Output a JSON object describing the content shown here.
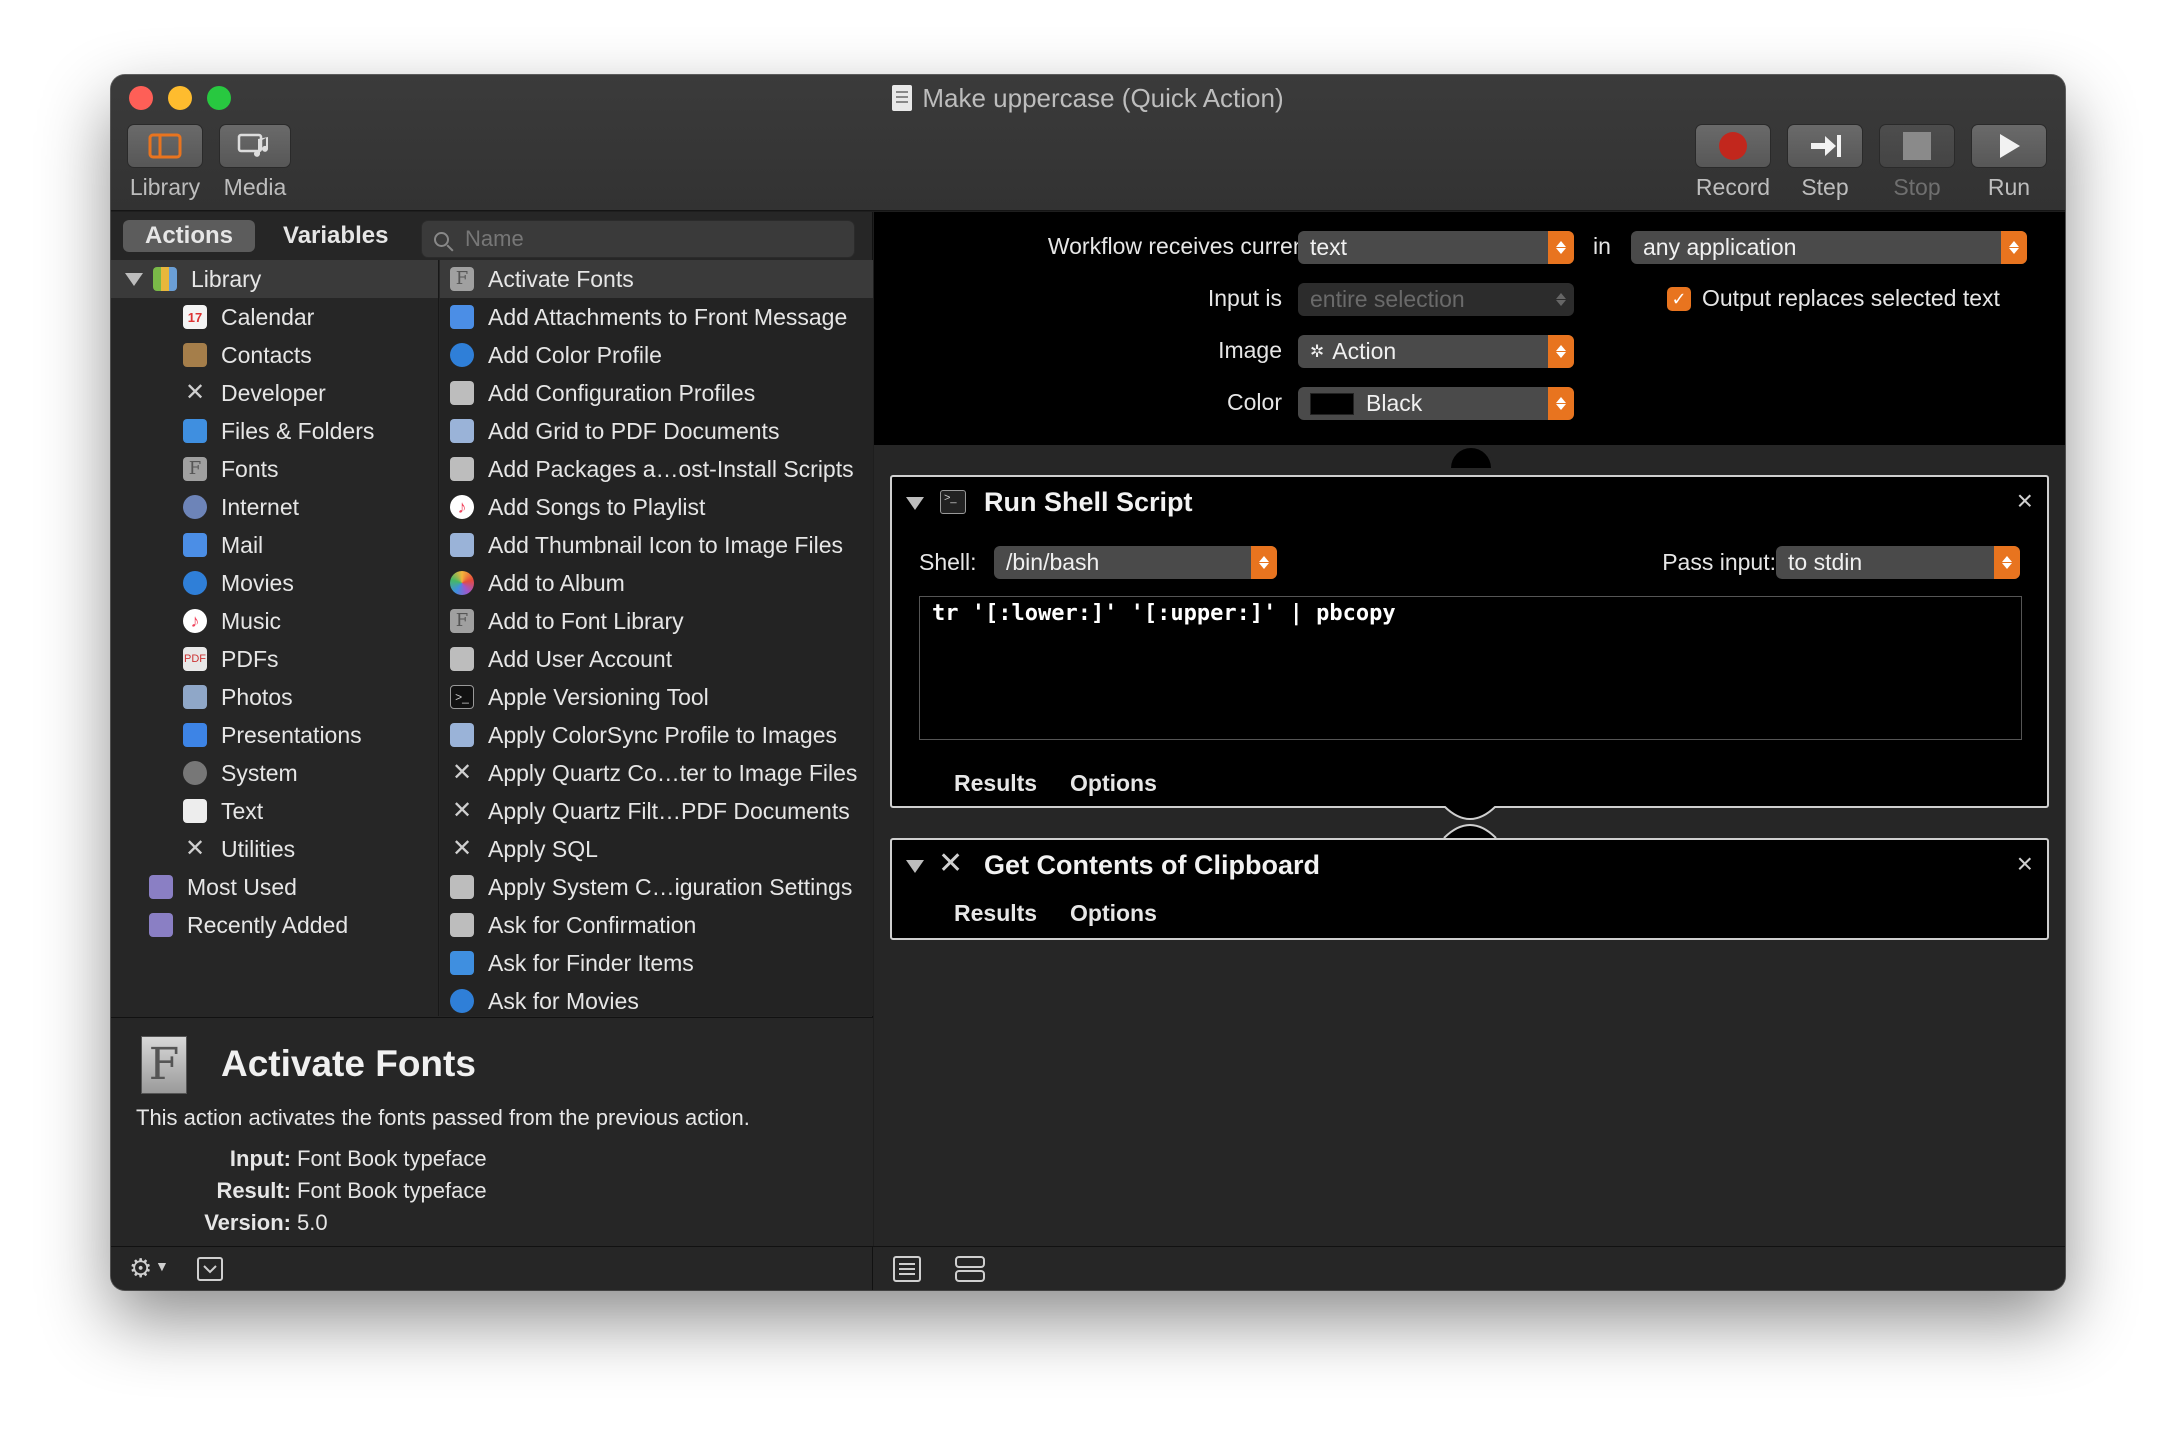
{
  "window": {
    "title": "Make uppercase (Quick Action)",
    "traffic_lights": {
      "close": "#fe5f57",
      "minimize": "#febc2e",
      "zoom": "#28c840"
    }
  },
  "toolbar": {
    "left": [
      {
        "label": "Library",
        "icon": "library-panel-icon"
      },
      {
        "label": "Media",
        "icon": "media-icon"
      }
    ],
    "right": [
      {
        "label": "Record",
        "icon": "record-icon",
        "enabled": true
      },
      {
        "label": "Step",
        "icon": "step-icon",
        "enabled": true
      },
      {
        "label": "Stop",
        "icon": "stop-icon",
        "enabled": false
      },
      {
        "label": "Run",
        "icon": "run-icon",
        "enabled": true
      }
    ]
  },
  "library_pane": {
    "tabs": [
      "Actions",
      "Variables"
    ],
    "active_tab": "Actions",
    "search_placeholder": "Name",
    "categories_root": "Library",
    "categories": [
      "Calendar",
      "Contacts",
      "Developer",
      "Files & Folders",
      "Fonts",
      "Internet",
      "Mail",
      "Movies",
      "Music",
      "PDFs",
      "Photos",
      "Presentations",
      "System",
      "Text",
      "Utilities"
    ],
    "smart_groups": [
      "Most Used",
      "Recently Added"
    ],
    "actions": [
      "Activate Fonts",
      "Add Attachments to Front Message",
      "Add Color Profile",
      "Add Configuration Profiles",
      "Add Grid to PDF Documents",
      "Add Packages a…ost-Install Scripts",
      "Add Songs to Playlist",
      "Add Thumbnail Icon to Image Files",
      "Add to Album",
      "Add to Font Library",
      "Add User Account",
      "Apple Versioning Tool",
      "Apply ColorSync Profile to Images",
      "Apply Quartz Co…ter to Image Files",
      "Apply Quartz Filt…PDF Documents",
      "Apply SQL",
      "Apply System C…iguration Settings",
      "Ask for Confirmation",
      "Ask for Finder Items",
      "Ask for Movies"
    ],
    "selected_action": "Activate Fonts"
  },
  "info": {
    "title": "Activate Fonts",
    "description": "This action activates the fonts passed from the previous action.",
    "input_label": "Input:",
    "input_value": "Font Book typeface",
    "result_label": "Result:",
    "result_value": "Font Book typeface",
    "version_label": "Version:",
    "version_value": "5.0"
  },
  "workflow": {
    "receives_label": "Workflow receives current",
    "receives_value": "text",
    "in_label": "in",
    "app_value": "any application",
    "input_is_label": "Input is",
    "input_is_value": "entire selection",
    "output_replaces_label": "Output replaces selected text",
    "output_replaces_checked": true,
    "image_label": "Image",
    "image_value": "Action",
    "color_label": "Color",
    "color_value": "Black",
    "color_swatch": "#000000"
  },
  "actions_in_workflow": [
    {
      "title": "Run Shell Script",
      "shell_label": "Shell:",
      "shell_value": "/bin/bash",
      "pass_input_label": "Pass input:",
      "pass_input_value": "to stdin",
      "script": "tr '[:lower:]' '[:upper:]' | pbcopy",
      "tabs": [
        "Results",
        "Options"
      ]
    },
    {
      "title": "Get Contents of Clipboard",
      "tabs": [
        "Results",
        "Options"
      ]
    }
  ],
  "accent_color": "#e8741f"
}
